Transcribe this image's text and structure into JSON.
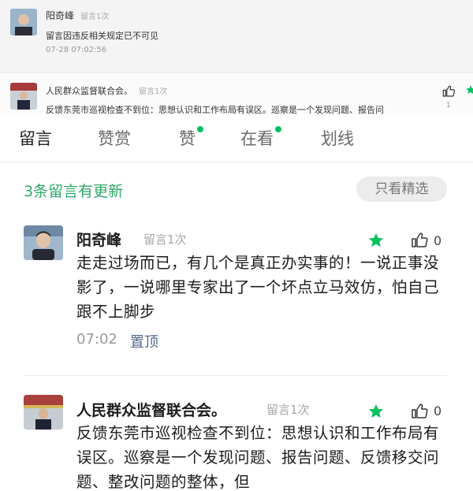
{
  "top_comment": {
    "name": "阳奇峰",
    "tag": "留言1次",
    "text": "留言因违反相关规定已不可见",
    "time": "07-28 07:02:56"
  },
  "reply_strip": {
    "name": "人民群众监督联合会。",
    "tag": "留言1次",
    "text": "反馈东莞市巡视检查不到位：思想认识和工作布局有误区。巡察是一个发现问题、报告问",
    "like_count": "1"
  },
  "tabs": [
    {
      "label": "留言",
      "active": true,
      "dot": false
    },
    {
      "label": "赞赏",
      "active": false,
      "dot": false
    },
    {
      "label": "赞",
      "active": false,
      "dot": true
    },
    {
      "label": "在看",
      "active": false,
      "dot": true
    },
    {
      "label": "划线",
      "active": false,
      "dot": false
    }
  ],
  "update_text": "3条留言有更新",
  "filter_label": "只看精选",
  "comments": [
    {
      "name": "阳奇峰",
      "tag": "留言1次",
      "likes": "0",
      "body": "走走过场而已，有几个是真正办实事的！一说正事没影了，一说哪里专家出了一个坏点立马效仿，怕自己跟不上脚步",
      "time": "07:02",
      "pin_label": "置顶"
    },
    {
      "name": "人民群众监督联合会。",
      "tag": "留言1次",
      "likes": "0",
      "body": "反馈东莞市巡视检查不到位：思想认识和工作布局有误区。巡察是一个发现问题、报告问题、反馈移交问题、整改问题的整体，但"
    }
  ],
  "colors": {
    "accent_green": "#07c160",
    "update_green": "#2fa86a",
    "pin_blue": "#56688a"
  }
}
